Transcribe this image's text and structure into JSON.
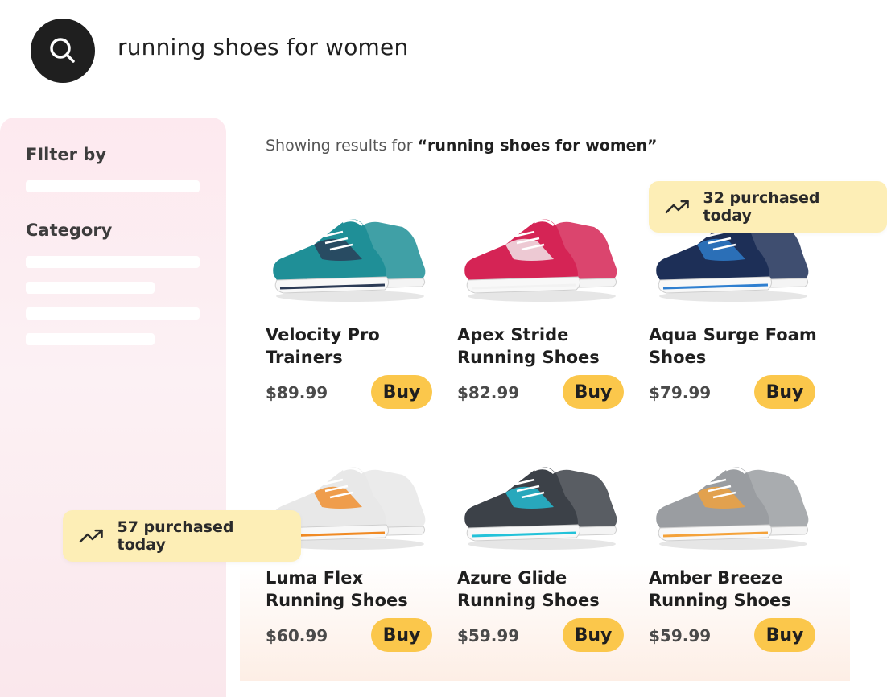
{
  "search": {
    "query": "running shoes for women"
  },
  "sidebar": {
    "filter_heading": "FIlter by",
    "category_heading": "Category"
  },
  "results": {
    "prefix": "Showing results for ",
    "query_quoted": "“running shoes for women”"
  },
  "products": [
    {
      "name": "Velocity Pro Trainers",
      "price": "$89.99",
      "buy": "Buy",
      "colors": [
        "#1f8f97",
        "#2b3a55"
      ]
    },
    {
      "name": "Apex Stride Running Shoes",
      "price": "$82.99",
      "buy": "Buy",
      "colors": [
        "#d52455",
        "#f2f2f2"
      ]
    },
    {
      "name": "Aqua Surge Foam Shoes",
      "price": "$79.99",
      "buy": "Buy",
      "colors": [
        "#1d2f57",
        "#2f7fd0"
      ]
    },
    {
      "name": "Luma Flex Running Shoes",
      "price": "$60.99",
      "buy": "Buy",
      "colors": [
        "#e8e8e8",
        "#f08a24"
      ]
    },
    {
      "name": "Azure Glide Running Shoes",
      "price": "$59.99",
      "buy": "Buy",
      "colors": [
        "#3c4148",
        "#23c2d9"
      ]
    },
    {
      "name": "Amber Breeze Running Shoes",
      "price": "$59.99",
      "buy": "Buy",
      "colors": [
        "#9a9da1",
        "#f4a23a"
      ]
    }
  ],
  "badges": {
    "top": "32 purchased today",
    "bottom": "57 purchased today"
  },
  "colors": {
    "accent": "#fbc74b",
    "badge": "#fdeeb6",
    "sidebar": "#fde9ef"
  },
  "icons": {
    "search": "search-icon",
    "trend": "trending-up-icon"
  }
}
